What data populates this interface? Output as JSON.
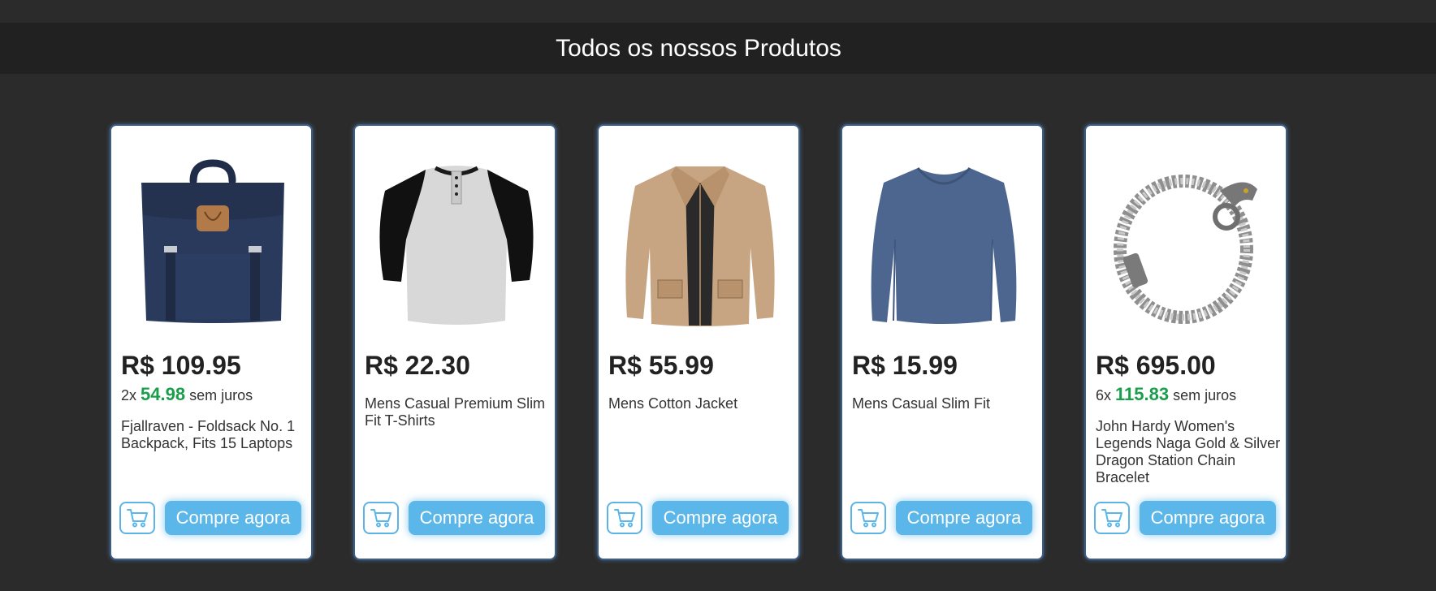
{
  "header": {
    "title": "Todos os nossos Produtos"
  },
  "colors": {
    "accent": "#5bb6ea",
    "installment_value": "#1a9e4b",
    "background": "#2b2b2b",
    "header_bar": "#212121"
  },
  "products": [
    {
      "price": "R$ 109.95",
      "installments": {
        "count": "2x",
        "value": "54.98",
        "suffix": "sem juros"
      },
      "title": "Fjallraven - Foldsack No. 1 Backpack, Fits 15 Laptops",
      "image_icon": "backpack-image",
      "cart_icon": "shopping-cart-icon",
      "buy_label": "Compre agora"
    },
    {
      "price": "R$ 22.30",
      "installments": null,
      "title": "Mens Casual Premium Slim Fit T-Shirts",
      "image_icon": "raglan-tshirt-image",
      "cart_icon": "shopping-cart-icon",
      "buy_label": "Compre agora"
    },
    {
      "price": "R$ 55.99",
      "installments": null,
      "title": "Mens Cotton Jacket",
      "image_icon": "jacket-image",
      "cart_icon": "shopping-cart-icon",
      "buy_label": "Compre agora"
    },
    {
      "price": "R$ 15.99",
      "installments": null,
      "title": "Mens Casual Slim Fit",
      "image_icon": "long-sleeve-shirt-image",
      "cart_icon": "shopping-cart-icon",
      "buy_label": "Compre agora"
    },
    {
      "price": "R$ 695.00",
      "installments": {
        "count": "6x",
        "value": "115.83",
        "suffix": "sem juros"
      },
      "title": "John Hardy Women's Legends Naga Gold & Silver Dragon Station Chain Bracelet",
      "image_icon": "dragon-bracelet-image",
      "cart_icon": "shopping-cart-icon",
      "buy_label": "Compre agora"
    }
  ]
}
